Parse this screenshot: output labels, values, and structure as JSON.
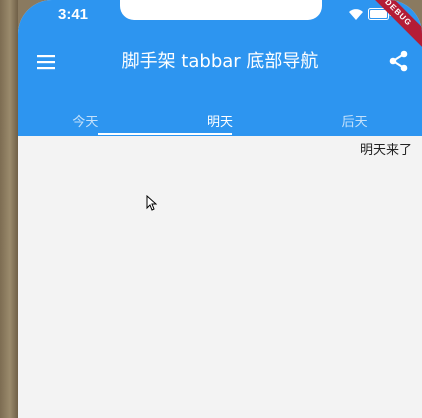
{
  "status_bar": {
    "time": "3:41",
    "icons": [
      "wifi-icon",
      "battery-icon"
    ]
  },
  "debug_banner": "DEBUG",
  "app_bar": {
    "title": "脚手架 tabbar 底部导航",
    "leading_icon": "menu-icon",
    "action_icon": "share-icon",
    "background_color": "#2d95f0"
  },
  "tabs": [
    {
      "label": "今天",
      "active": false
    },
    {
      "label": "明天",
      "active": true
    },
    {
      "label": "后天",
      "active": false
    }
  ],
  "content": {
    "text": "明天来了"
  }
}
